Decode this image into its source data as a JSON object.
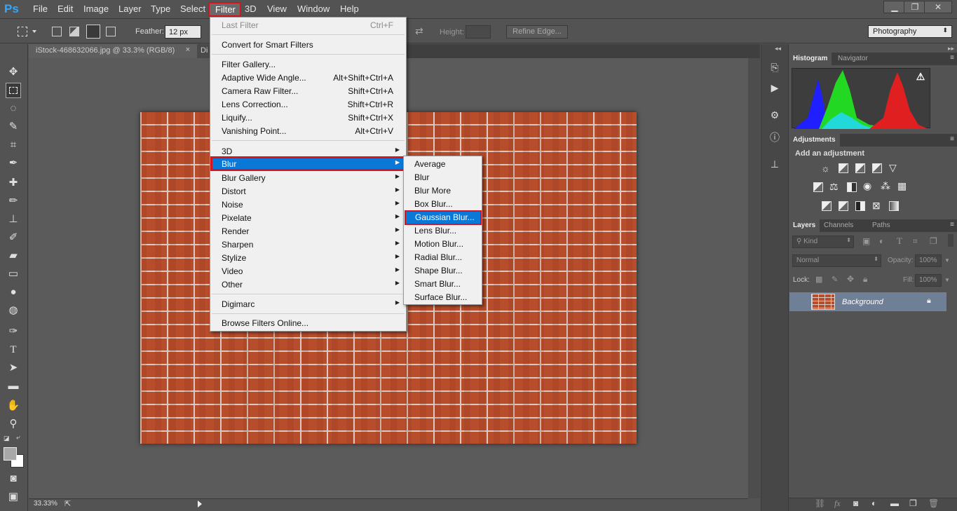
{
  "app": {
    "logo": "Ps"
  },
  "menubar": {
    "items": [
      "File",
      "Edit",
      "Image",
      "Layer",
      "Type",
      "Select",
      "Filter",
      "3D",
      "View",
      "Window",
      "Help"
    ],
    "active": "Filter"
  },
  "window_controls": {
    "minimize": "▁",
    "restore": "❐",
    "close": "✕"
  },
  "options_bar": {
    "feather_label": "Feather:",
    "feather_value": "12 px",
    "height_label": "Height:",
    "refine_edge": "Refine Edge...",
    "workspace": "Photography"
  },
  "document": {
    "tab_title": "iStock-468632066.jpg @ 33.3% (RGB/8)",
    "tab_close": "×",
    "tab2_title": "Di",
    "zoom": "33.33%"
  },
  "filter_menu": {
    "last_filter": {
      "label": "Last Filter",
      "shortcut": "Ctrl+F"
    },
    "convert": "Convert for Smart Filters",
    "group1": [
      {
        "label": "Filter Gallery...",
        "shortcut": ""
      },
      {
        "label": "Adaptive Wide Angle...",
        "shortcut": "Alt+Shift+Ctrl+A"
      },
      {
        "label": "Camera Raw Filter...",
        "shortcut": "Shift+Ctrl+A"
      },
      {
        "label": "Lens Correction...",
        "shortcut": "Shift+Ctrl+R"
      },
      {
        "label": "Liquify...",
        "shortcut": "Shift+Ctrl+X"
      },
      {
        "label": "Vanishing Point...",
        "shortcut": "Alt+Ctrl+V"
      }
    ],
    "submenus": [
      "3D",
      "Blur",
      "Blur Gallery",
      "Distort",
      "Noise",
      "Pixelate",
      "Render",
      "Sharpen",
      "Stylize",
      "Video",
      "Other"
    ],
    "digimarc": "Digimarc",
    "browse": "Browse Filters Online..."
  },
  "blur_menu": {
    "items": [
      "Average",
      "Blur",
      "Blur More",
      "Box Blur...",
      "Gaussian Blur...",
      "Lens Blur...",
      "Motion Blur...",
      "Radial Blur...",
      "Shape Blur...",
      "Smart Blur...",
      "Surface Blur..."
    ],
    "highlighted": "Gaussian Blur..."
  },
  "panels": {
    "histogram_tab": "Histogram",
    "navigator_tab": "Navigator",
    "adjustments_tab": "Adjustments",
    "add_adjustment": "Add an adjustment",
    "layers_tab": "Layers",
    "channels_tab": "Channels",
    "paths_tab": "Paths",
    "kind": "Kind",
    "blend_mode": "Normal",
    "opacity_label": "Opacity:",
    "opacity_value": "100%",
    "lock_label": "Lock:",
    "fill_label": "Fill:",
    "fill_value": "100%",
    "layer_name": "Background"
  },
  "colors": {
    "highlight": "#0a78d6",
    "callout": "#d4141e",
    "brick": "#b84d2c"
  }
}
